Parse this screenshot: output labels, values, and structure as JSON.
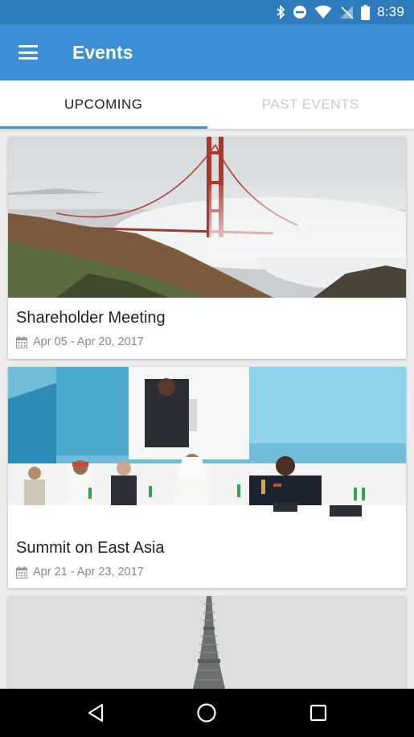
{
  "status_bar": {
    "time": "8:39",
    "icons": [
      "bluetooth-icon",
      "do-not-disturb-icon",
      "wifi-icon",
      "no-signal-icon",
      "battery-icon"
    ]
  },
  "app_bar": {
    "title": "Events",
    "menu_icon": "hamburger-menu-icon",
    "color": "#3d8fd5"
  },
  "tabs": [
    {
      "label": "UPCOMING",
      "active": true
    },
    {
      "label": "PAST EVENTS",
      "active": false
    }
  ],
  "events": [
    {
      "title": "Shareholder Meeting",
      "dates": "Apr 05 - Apr 20, 2017",
      "image": "golden-gate-bridge-fog-photo"
    },
    {
      "title": "Summit on East Asia",
      "dates": "Apr 21 - Apr 23, 2017",
      "image": "conference-panel-photo"
    },
    {
      "title": "",
      "dates": "",
      "image": "eiffel-tower-photo"
    }
  ],
  "nav_bar": {
    "icons": [
      "back-icon",
      "home-icon",
      "recents-icon"
    ]
  },
  "colors": {
    "status_bar": "#2f7cbc",
    "accent": "#3d8fd5"
  }
}
